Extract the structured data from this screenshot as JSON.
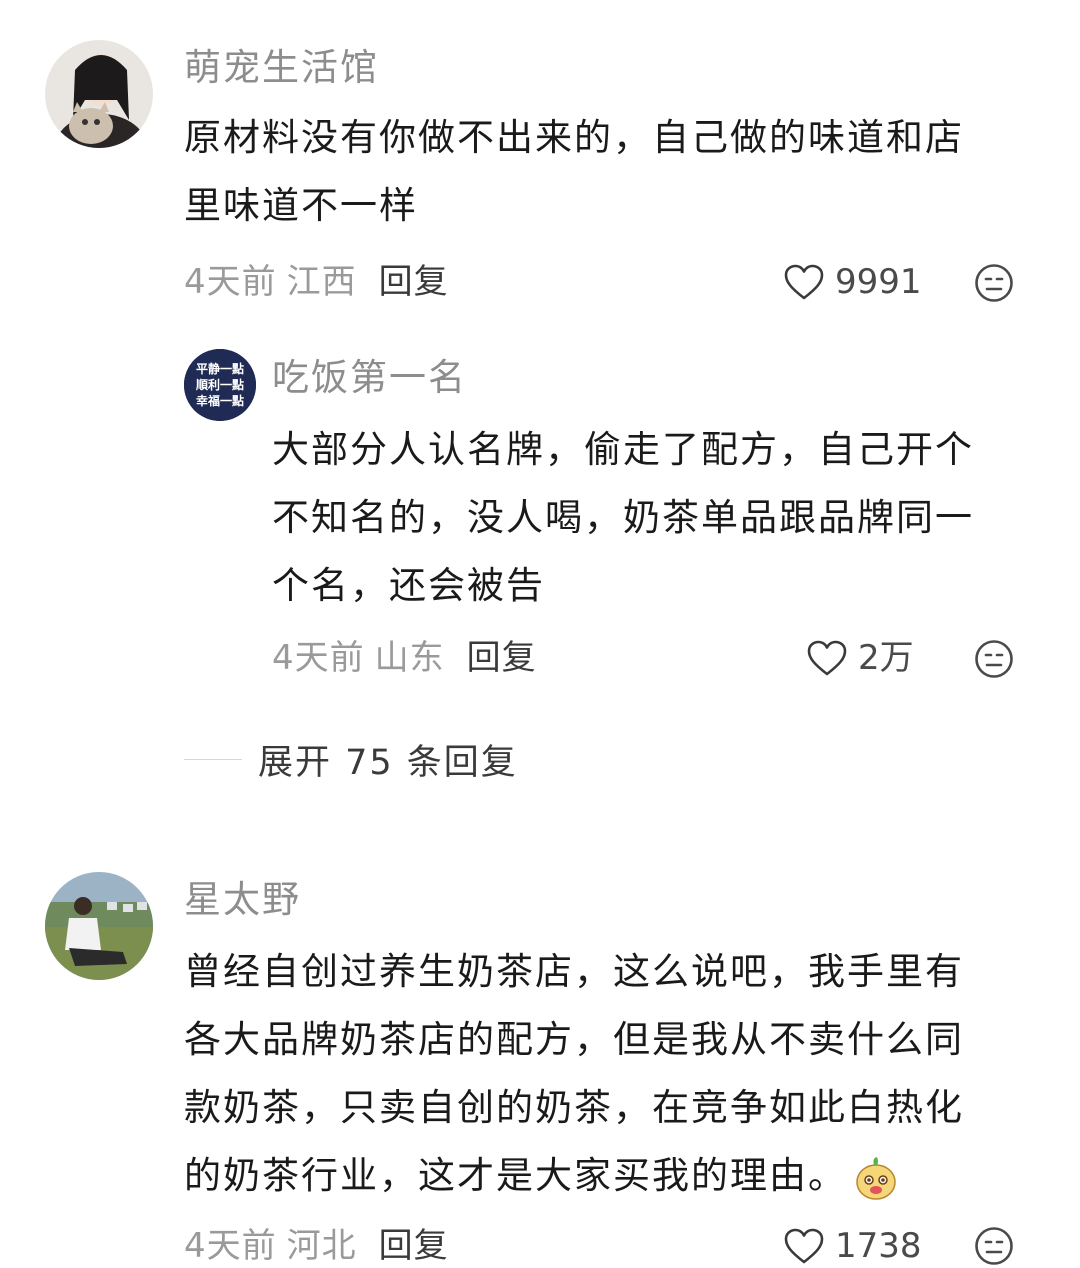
{
  "comments": [
    {
      "username": "萌宠生活馆",
      "content_lines": [
        "原材料没有你做不出来的，自己做的味道和店",
        "里味道不一样"
      ],
      "time": "4天前",
      "location": "江西",
      "reply_label": "回复",
      "likes": "9991"
    },
    {
      "username": "吃饭第一名",
      "avatar_text": [
        "平静一點",
        "順利一點",
        "幸福一點"
      ],
      "content_lines": [
        "大部分人认名牌，偷走了配方，自己开个",
        "不知名的，没人喝，奶茶单品跟品牌同一",
        "个名，还会被告"
      ],
      "time": "4天前",
      "location": "山东",
      "reply_label": "回复",
      "likes": "2万"
    },
    {
      "username": "星太野",
      "content_lines": [
        "曾经自创过养生奶茶店，这么说吧，我手里有",
        "各大品牌奶茶店的配方，但是我从不卖什么同",
        "款奶茶，只卖自创的奶茶，在竞争如此白热化",
        "的奶茶行业，这才是大家买我的理由。"
      ],
      "time": "4天前",
      "location": "河北",
      "reply_label": "回复",
      "likes": "1738"
    }
  ],
  "expand_replies": "展开 75 条回复",
  "icons": {
    "like": "heart-outline-icon",
    "dislike": "meh-face-icon",
    "emoji": "mascot-emoji-icon"
  }
}
